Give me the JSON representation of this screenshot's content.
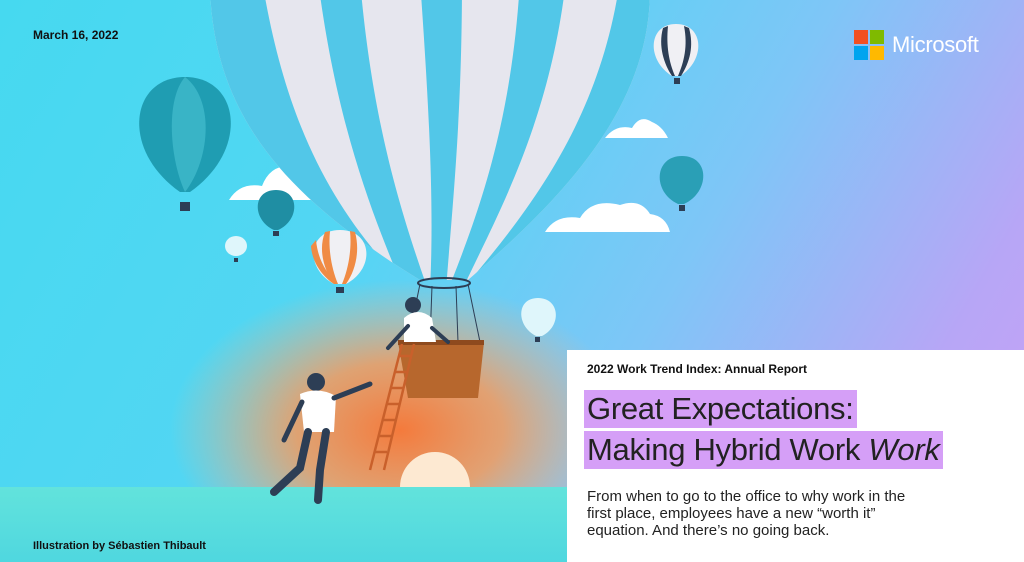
{
  "header": {
    "date": "March 16, 2022"
  },
  "brand": {
    "name": "Microsoft",
    "logo_colors": [
      "#f25022",
      "#7fba00",
      "#00a4ef",
      "#ffb900"
    ]
  },
  "card": {
    "kicker": "2022 Work Trend Index: Annual Report",
    "title_line1": "Great Expectations:",
    "title_line2_plain": "Making Hybrid Work ",
    "title_line2_italic": "Work",
    "body": "From when to go to the office to why work in the first place, employees have a new “worth it” equation. And there’s no going back."
  },
  "footer": {
    "credit": "Illustration by Sébastien Thibault"
  },
  "colors": {
    "highlight": "#d59ff7",
    "sky_start": "#46d9f0",
    "sky_end": "#c9a1f6",
    "sunset": "#f6894a",
    "ground": "#5fe0d9"
  }
}
